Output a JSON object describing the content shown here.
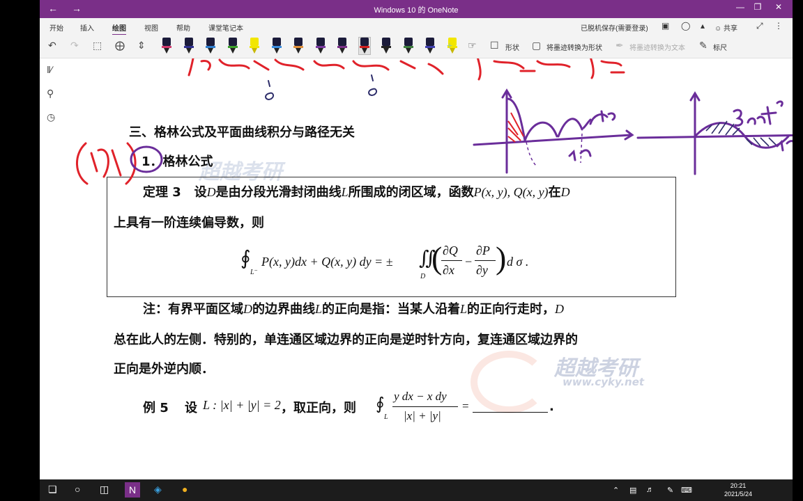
{
  "window": {
    "title": "Windows 10 的 OneNote",
    "back": "←",
    "forward": "→",
    "save_status": "已脱机保存(需要登录)",
    "share": "共享"
  },
  "menu": {
    "tabs": [
      "开始",
      "插入",
      "绘图",
      "视图",
      "帮助",
      "课堂笔记本"
    ],
    "active": "绘图"
  },
  "toolbar": {
    "shapes_label": "形状",
    "ink_to_shape_label": "将墨迹转换为形状",
    "ink_to_text_label": "将墨迹转换为文本",
    "ruler_label": "标尺",
    "pens": [
      {
        "body": "#1b1b3a",
        "band": "#d23a6e"
      },
      {
        "body": "#1b1b3a",
        "band": "#2f2f8f"
      },
      {
        "body": "#1b1b3a",
        "band": "#2f7fd0"
      },
      {
        "body": "#1b1b3a",
        "band": "#3aa02a"
      },
      {
        "body": "#f2e600",
        "band": "#f2e600"
      },
      {
        "body": "#1b1b3a",
        "band": "#3a8ee0"
      },
      {
        "body": "#1b1b3a",
        "band": "#e0903a"
      },
      {
        "body": "#1b1b3a",
        "band": "#7a3aa0"
      },
      {
        "body": "#1b1b3a",
        "band": "#7a2f88"
      },
      {
        "body": "#1b1b3a",
        "band": "#d42020"
      },
      {
        "body": "#1b1b3a",
        "band": "#222222"
      },
      {
        "body": "#1b1b3a",
        "band": "#3f7f3f"
      },
      {
        "body": "#1b1b3a",
        "band": "#3f3faf"
      },
      {
        "body": "#f2e600",
        "band": "#f2e600"
      }
    ]
  },
  "doc": {
    "section_heading": "三、格林公式及平面曲线积分与路径无关",
    "sub_heading": "1．格林公式",
    "theorem_prefix": "定理 3",
    "theorem_text_a": "设",
    "sym_D": "D",
    "theorem_text_b": "是由分段光滑封闭曲线",
    "sym_L": "L",
    "theorem_text_c": "所围成的闭区域，函数",
    "theorem_funcs": "P(x, y), Q(x, y)",
    "theorem_text_d": "在",
    "theorem_line2": "上具有一阶连续偏导数，则",
    "formula": {
      "integral_sign": "∮",
      "sub_L": "L⁻",
      "lhs": "P(x, y)dx + Q(x, y) dy = ±",
      "double_int": "∬",
      "sub_D": "D",
      "frac1_num": "∂Q",
      "frac1_den": "∂x",
      "minus": "−",
      "frac2_num": "∂P",
      "frac2_den": "∂y",
      "tail": "d σ ."
    },
    "note_a": "注：有界平面区域",
    "note_b": "的边界曲线",
    "note_c": "的正向是指：当某人沿着",
    "note_d": "的正向行走时，",
    "note_line2": "总在此人的左侧．特别的，单连通区域边界的正向是逆时针方向，复连通区域边界的",
    "note_line3": "正向是外逆内顺．",
    "example_label": "例 5",
    "example_set": "设",
    "example_expr": "L : |x| + |y| = 2",
    "example_text": "，取正向，则",
    "example_int": "∮",
    "example_num": "y dx − x dy",
    "example_den": "|x| + |y|",
    "example_eq": "=",
    "example_period": "."
  },
  "watermarks": {
    "brand": "超越考研",
    "url": "www.cyky.net"
  },
  "taskbar": {
    "time": "20:21",
    "date": "2021/5/24"
  },
  "colors": {
    "accent": "#7a2f88",
    "ink_red": "#e0222a",
    "ink_purple": "#6a2d9a"
  }
}
